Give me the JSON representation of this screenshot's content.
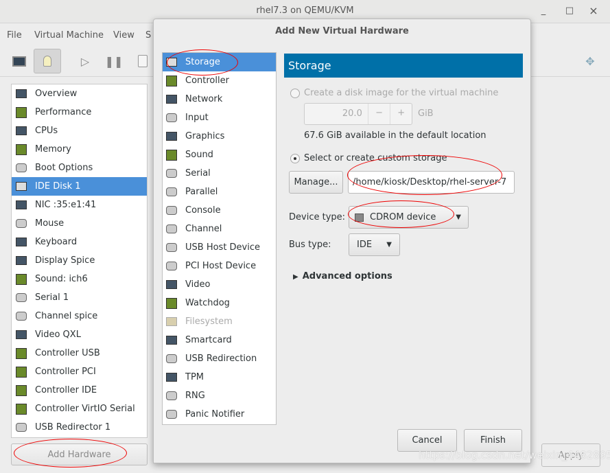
{
  "window": {
    "title": "rhel7.3 on QEMU/KVM",
    "minimize": "_",
    "maximize": "□",
    "close": "×"
  },
  "menubar": [
    "File",
    "Virtual Machine",
    "View",
    "S"
  ],
  "toolbar": {
    "icons": [
      "monitor-icon",
      "lightbulb-icon",
      "play-icon",
      "pause-icon",
      "power-icon",
      "fullscreen-icon"
    ]
  },
  "hardware_list": [
    {
      "label": "Overview",
      "icon": "overview-icon"
    },
    {
      "label": "Performance",
      "icon": "performance-icon"
    },
    {
      "label": "CPUs",
      "icon": "cpu-icon"
    },
    {
      "label": "Memory",
      "icon": "memory-icon"
    },
    {
      "label": "Boot Options",
      "icon": "gear-icon"
    },
    {
      "label": "IDE Disk 1",
      "icon": "disk-icon",
      "selected": true
    },
    {
      "label": "NIC :35:e1:41",
      "icon": "nic-icon"
    },
    {
      "label": "Mouse",
      "icon": "mouse-icon"
    },
    {
      "label": "Keyboard",
      "icon": "keyboard-icon"
    },
    {
      "label": "Display Spice",
      "icon": "display-icon"
    },
    {
      "label": "Sound: ich6",
      "icon": "sound-icon"
    },
    {
      "label": "Serial 1",
      "icon": "serial-icon"
    },
    {
      "label": "Channel spice",
      "icon": "channel-icon"
    },
    {
      "label": "Video QXL",
      "icon": "video-icon"
    },
    {
      "label": "Controller USB",
      "icon": "controller-icon"
    },
    {
      "label": "Controller PCI",
      "icon": "controller-icon"
    },
    {
      "label": "Controller IDE",
      "icon": "controller-icon"
    },
    {
      "label": "Controller VirtIO Serial",
      "icon": "controller-icon"
    },
    {
      "label": "USB Redirector 1",
      "icon": "usb-redirect-icon"
    }
  ],
  "add_hardware_label": "Add Hardware",
  "apply_label": "Apply",
  "dialog": {
    "title": "Add New Virtual Hardware",
    "types": [
      {
        "label": "Storage",
        "icon": "storage-icon",
        "selected": true
      },
      {
        "label": "Controller",
        "icon": "controller-icon"
      },
      {
        "label": "Network",
        "icon": "network-icon"
      },
      {
        "label": "Input",
        "icon": "mouse-icon"
      },
      {
        "label": "Graphics",
        "icon": "display-icon"
      },
      {
        "label": "Sound",
        "icon": "sound-icon"
      },
      {
        "label": "Serial",
        "icon": "serial-icon"
      },
      {
        "label": "Parallel",
        "icon": "parallel-icon"
      },
      {
        "label": "Console",
        "icon": "console-icon"
      },
      {
        "label": "Channel",
        "icon": "channel-icon"
      },
      {
        "label": "USB Host Device",
        "icon": "usb-icon"
      },
      {
        "label": "PCI Host Device",
        "icon": "pci-icon"
      },
      {
        "label": "Video",
        "icon": "video-icon"
      },
      {
        "label": "Watchdog",
        "icon": "watchdog-icon"
      },
      {
        "label": "Filesystem",
        "icon": "folder-icon",
        "disabled": true
      },
      {
        "label": "Smartcard",
        "icon": "smartcard-icon"
      },
      {
        "label": "USB Redirection",
        "icon": "usb-redirect-icon"
      },
      {
        "label": "TPM",
        "icon": "tpm-icon"
      },
      {
        "label": "RNG",
        "icon": "rng-icon"
      },
      {
        "label": "Panic Notifier",
        "icon": "panic-icon"
      }
    ],
    "header": "Storage",
    "create_disk_label": "Create a disk image for the virtual machine",
    "disk_size": "20.0",
    "minus": "−",
    "plus": "+",
    "unit": "GiB",
    "available": "67.6 GiB available in the default location",
    "custom_label": "Select or create custom storage",
    "manage_label": "Manage...",
    "path": "/home/kiosk/Desktop/rhel-server-7",
    "device_type_label": "Device type:",
    "device_type": "CDROM device",
    "bus_type_label": "Bus type:",
    "bus_type": "IDE",
    "advanced": "Advanced options",
    "cancel": "Cancel",
    "finish": "Finish"
  },
  "watermark": "https://blog.csdn.net/weixin_44828950",
  "colors": {
    "header": "#0070a8",
    "selection": "#4a90d9",
    "annotation": "#e00000"
  }
}
